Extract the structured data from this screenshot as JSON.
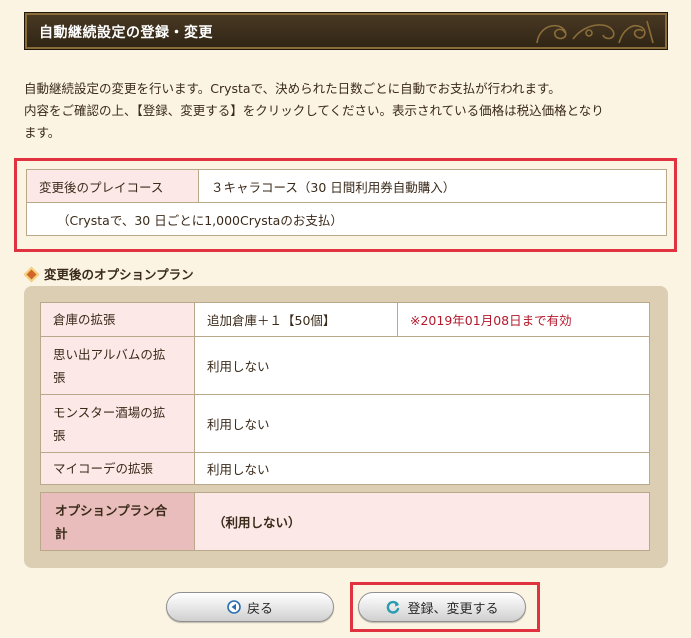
{
  "header": {
    "title": "自動継続設定の登録・変更"
  },
  "intro": {
    "line1": "自動継続設定の変更を行います。Crystaで、決められた日数ごとに自動でお支払が行われます。",
    "line2": "内容をご確認の上、【登録、変更する】をクリックしてください。表示されている価格は税込価格となり",
    "line3": "ます。"
  },
  "play_course": {
    "label": "変更後のプレイコース",
    "value": "３キャラコース（30 日間利用券自動購入）",
    "payment": "（Crystaで、30 日ごとに1,000Crystaのお支払）"
  },
  "options": {
    "title": "変更後のオプションプラン",
    "rows": [
      {
        "label": "倉庫の拡張",
        "value": "追加倉庫＋１【50個】",
        "note": "※2019年01月08日まで有効"
      },
      {
        "label_l1": "思い出アルバムの拡",
        "label_l2": "張",
        "value": "利用しない"
      },
      {
        "label_l1": "モンスター酒場の拡",
        "label_l2": "張",
        "value": "利用しない"
      },
      {
        "label": "マイコーデの拡張",
        "value": "利用しない"
      }
    ],
    "total": {
      "label_l1": "オプションプラン合",
      "label_l2": "計",
      "value": "（利用しない）"
    }
  },
  "buttons": {
    "back_label": "戻る",
    "submit_label": "登録、変更する"
  },
  "colors": {
    "highlight_border": "#e0333f",
    "note_text": "#b2192c",
    "label_bg": "#fde8e8"
  },
  "icons": {
    "back": "circle-left-arrow-icon",
    "submit": "circular-arrow-icon"
  }
}
